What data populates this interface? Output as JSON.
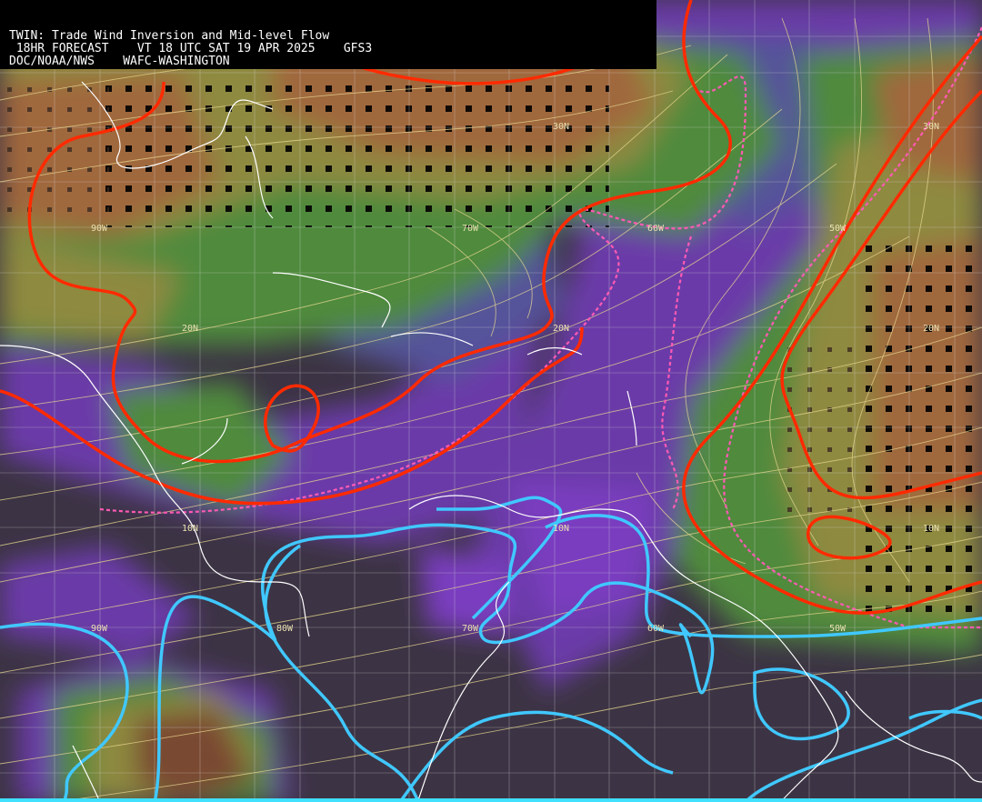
{
  "header": {
    "title": "TWIN: Trade Wind Inversion and Mid-level Flow",
    "forecast_line": " 18HR FORECAST    VT 18 UTC SAT 19 APR 2025    GFS3",
    "source_line": "DOC/NOAA/NWS    WAFC-WASHINGTON"
  },
  "grid_labels": {
    "lat": [
      "30N",
      "30N",
      "20N",
      "20N",
      "20N",
      "10N",
      "10N",
      "10N"
    ],
    "lon": [
      "90W",
      "70W",
      "60W",
      "50W",
      "90W",
      "80W",
      "70W",
      "60W",
      "50W"
    ]
  },
  "colors": {
    "background": "#3c3444",
    "purple": "#7a3cc0",
    "slate_blue": "#55529a",
    "green": "#4f8a3c",
    "olive": "#8e8a40",
    "brown": "#a0683c",
    "dark_brown": "#7a4a30",
    "red_contour": "#ff2a00",
    "cyan_contour": "#40c8ff",
    "magenta_dash": "#ff5ab4",
    "streamline": "#e8d890",
    "coast": "#ffffff"
  }
}
